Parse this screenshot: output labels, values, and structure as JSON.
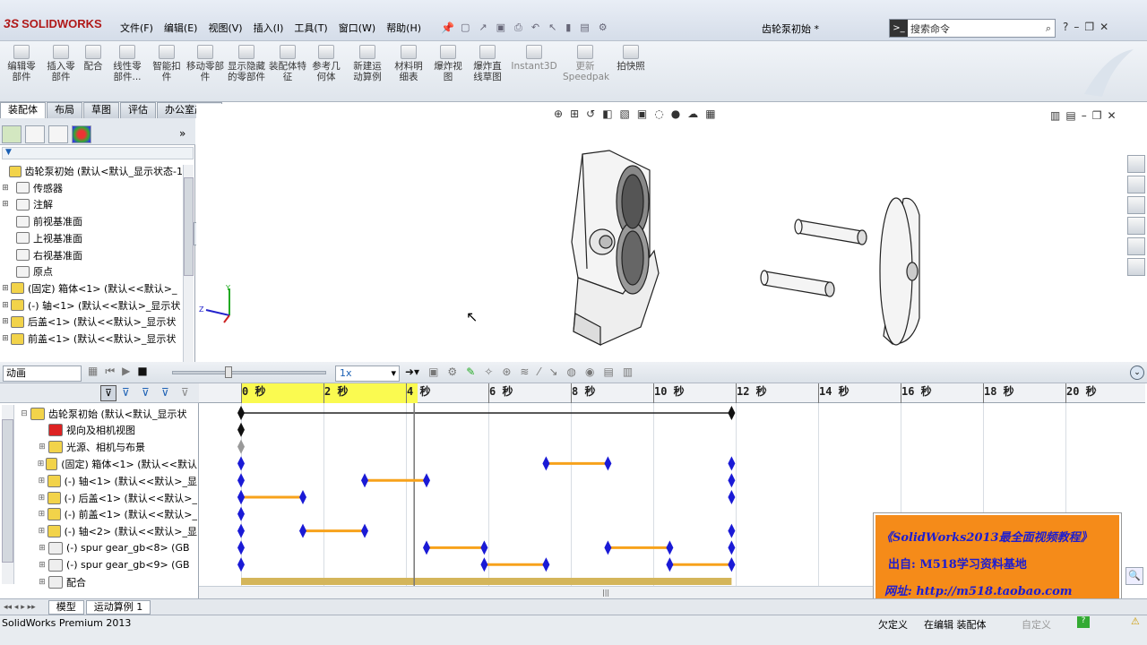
{
  "app": {
    "logo_ds": "3S",
    "logo": "SOLIDWORKS",
    "doc_title": "齿轮泵初始 *"
  },
  "menu": [
    "文件(F)",
    "编辑(E)",
    "视图(V)",
    "插入(I)",
    "工具(T)",
    "窗口(W)",
    "帮助(H)"
  ],
  "search": {
    "placeholder": "搜索命令"
  },
  "commands": [
    "编辑零部件",
    "插入零部件",
    "配合",
    "线性零部件...",
    "智能扣件",
    "移动零部件",
    "显示隐藏的零部件",
    "装配体特征",
    "参考几何体",
    "新建运动算例",
    "材料明细表",
    "爆炸视图",
    "爆炸直线草图",
    "Instant3D",
    "更新Speedpak",
    "拍快照"
  ],
  "tabs": [
    "装配体",
    "布局",
    "草图",
    "评估",
    "办公室产品"
  ],
  "feature_tree": {
    "filter_label": "▼",
    "items": [
      "齿轮泵初始 (默认<默认_显示状态-1",
      "传感器",
      "注解",
      "前视基准面",
      "上视基准面",
      "右视基准面",
      "原点",
      "(固定) 箱体<1> (默认<<默认>_",
      "(-) 轴<1> (默认<<默认>_显示状",
      "后盖<1> (默认<<默认>_显示状",
      "前盖<1> (默认<<默认>_显示状"
    ]
  },
  "motion": {
    "study_type": "动画",
    "speed": "1x",
    "ticks": [
      "0 秒",
      "2 秒",
      "4 秒",
      "6 秒",
      "8 秒",
      "10 秒",
      "12 秒",
      "14 秒",
      "16 秒",
      "18 秒",
      "20 秒"
    ],
    "rows": [
      "齿轮泵初始 (默认<默认_显示状",
      "视向及相机视图",
      "光源、相机与布景",
      "(固定) 箱体<1> (默认<<默认",
      "(-) 轴<1> (默认<<默认>_显",
      "(-) 后盖<1> (默认<<默认>_",
      "(-) 前盖<1> (默认<<默认>_",
      "(-) 轴<2> (默认<<默认>_显",
      "(-) spur gear_gb<8> (GB",
      "(-) spur gear_gb<9> (GB",
      "配合"
    ],
    "bars": [
      {
        "row": 3,
        "from": 7.4,
        "to": 8.9
      },
      {
        "row": 4,
        "from": 3.0,
        "to": 4.5
      },
      {
        "row": 5,
        "from": 0,
        "to": 1.5
      },
      {
        "row": 7,
        "from": 1.5,
        "to": 3.0
      },
      {
        "row": 8,
        "from": 4.5,
        "to": 5.9
      },
      {
        "row": 8,
        "from": 8.9,
        "to": 10.4
      },
      {
        "row": 9,
        "from": 5.9,
        "to": 7.4
      },
      {
        "row": 9,
        "from": 10.4,
        "to": 11.9
      }
    ],
    "end_keys": [
      {
        "row": 0,
        "t": 11.9
      },
      {
        "row": 3,
        "t": 11.9
      },
      {
        "row": 4,
        "t": 11.9
      },
      {
        "row": 5,
        "t": 11.9
      },
      {
        "row": 7,
        "t": 11.9
      },
      {
        "row": 8,
        "t": 11.9
      },
      {
        "row": 9,
        "t": 11.9
      }
    ],
    "start_keys": [
      0,
      1,
      2,
      3,
      4,
      5,
      6,
      7,
      8,
      9
    ],
    "playhead": 4.2
  },
  "bottom_tabs": [
    "模型",
    "运动算例 1"
  ],
  "status": {
    "product": "SolidWorks Premium 2013",
    "s1": "欠定义",
    "s2": "在编辑 装配体",
    "s3": "自定义"
  },
  "watermark": {
    "line1": "《SolidWorks2013最全面视频教程》",
    "line2": "出自: M518学习资料基地",
    "line3": "网址: http://m518.taobao.com"
  },
  "colors": {
    "accent": "#f7a21b",
    "key": "#1a1ad6",
    "ruler_highlight": "#fafa50"
  }
}
